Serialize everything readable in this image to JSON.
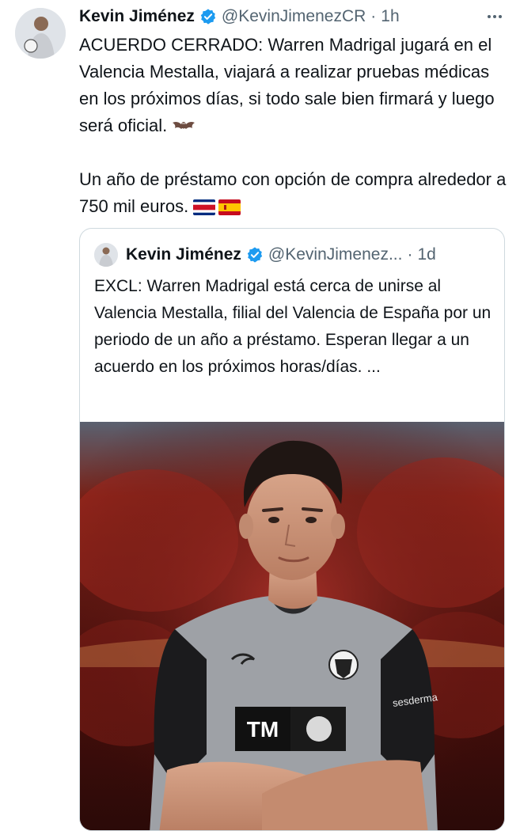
{
  "tweet": {
    "author": {
      "name": "Kevin Jiménez",
      "handle": "@KevinJimenezCR",
      "separator": "·",
      "time": "1h",
      "avatar_icon": "profile-photo"
    },
    "more_icon": "more-horizontal-icon",
    "verified_color": "#1d9bf0",
    "text_line1": "ACUERDO CERRADO: Warren Madrigal jugará en el Valencia Mestalla, viajará a realizar pruebas médicas en los próximos días, si todo sale bien firmará y luego será oficial.",
    "emoji1": "bat-emoji",
    "text_line2": "Un año de préstamo con opción de compra alrededor a 750 mil euros.",
    "emoji2": [
      "costa-rica-flag-emoji",
      "spain-flag-emoji"
    ]
  },
  "quote": {
    "author": {
      "name": "Kevin Jiménez",
      "handle": "@KevinJimenez...",
      "separator": "·",
      "time": "1d"
    },
    "text": "EXCL: Warren Madrigal está cerca de unirse al Valencia Mestalla, filial del Valencia de España por un periodo de un año a préstamo. Esperan llegar a un acuerdo en los próximos horas/días. ...",
    "image": {
      "shirt_text": "TM",
      "sponsor_text": "sesderma"
    }
  }
}
